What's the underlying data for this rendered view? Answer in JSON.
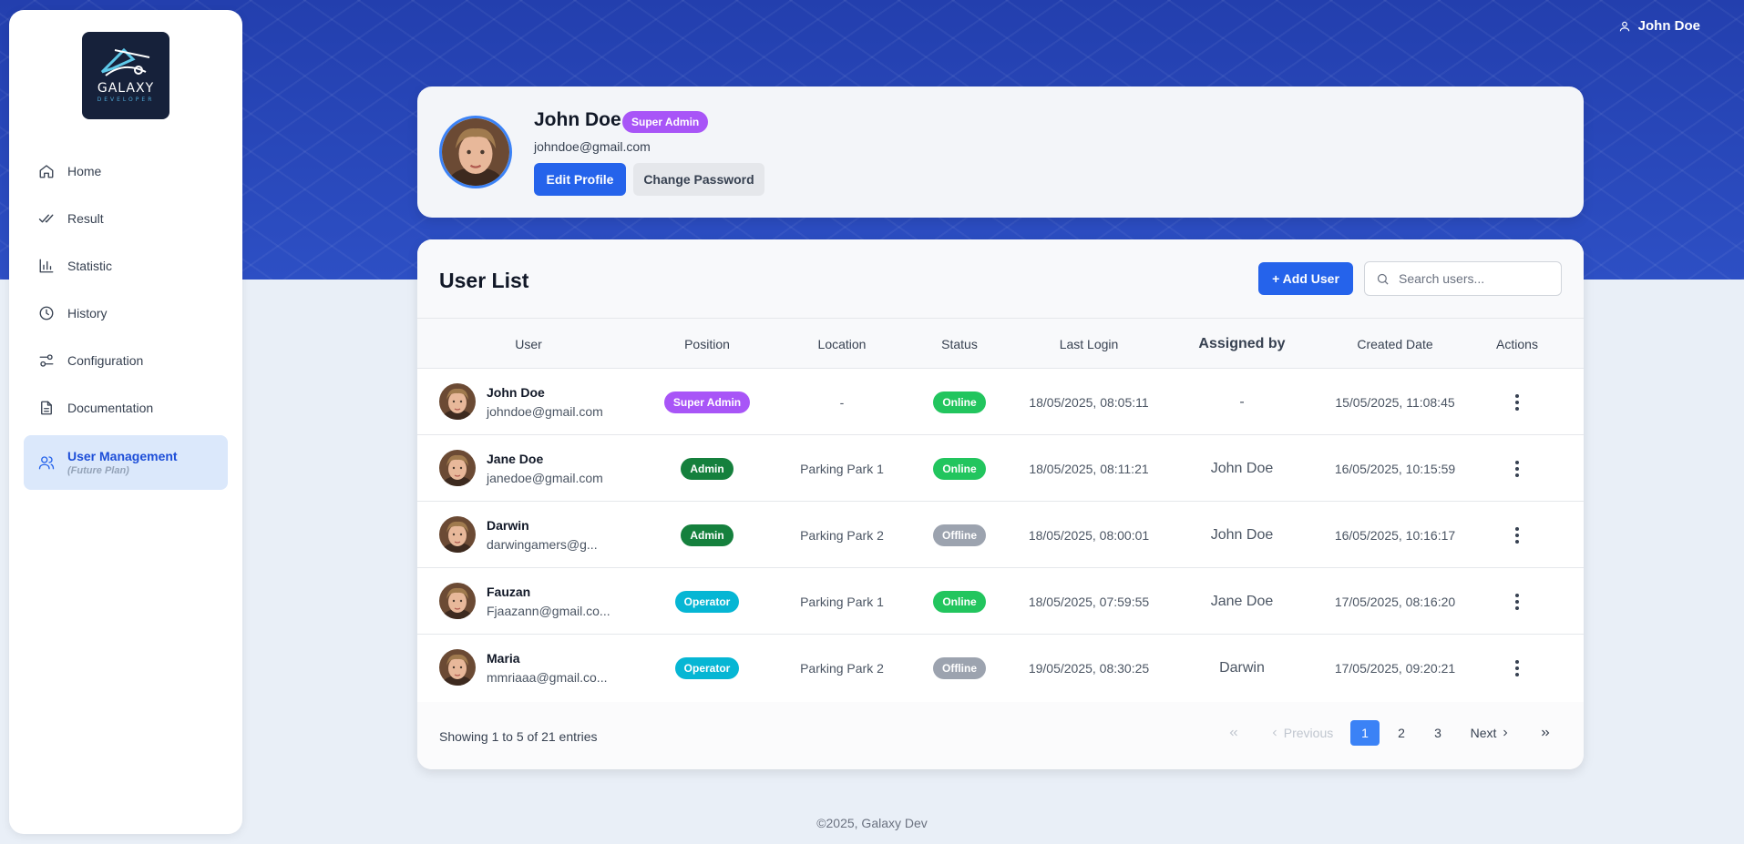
{
  "header": {
    "user_name": "John Doe",
    "user_icon": "user-icon"
  },
  "brand": {
    "name": "GALAXY",
    "tagline": "DEVELOPER"
  },
  "sidebar": {
    "items": [
      {
        "label": "Home",
        "icon": "home-icon"
      },
      {
        "label": "Result",
        "icon": "double-check-icon"
      },
      {
        "label": "Statistic",
        "icon": "bar-chart-icon"
      },
      {
        "label": "History",
        "icon": "clock-icon"
      },
      {
        "label": "Configuration",
        "icon": "sliders-icon"
      },
      {
        "label": "Documentation",
        "icon": "document-icon"
      },
      {
        "label": "User Management",
        "sublabel": "(Future Plan)",
        "icon": "users-icon",
        "active": true
      }
    ]
  },
  "profile": {
    "name": "John Doe",
    "role": "Super Admin",
    "email": "johndoe@gmail.com",
    "edit_label": "Edit Profile",
    "change_password_label": "Change Password"
  },
  "user_list": {
    "title": "User List",
    "add_label": "+ Add User",
    "search_placeholder": "Search users...",
    "columns": [
      "User",
      "Position",
      "Location",
      "Status",
      "Last Login",
      "Assigned by",
      "Created Date",
      "Actions"
    ],
    "rows": [
      {
        "name": "John Doe",
        "email": "johndoe@gmail.com",
        "position": "Super Admin",
        "location": "-",
        "status": "Online",
        "last_login": "18/05/2025, 08:05:11",
        "assigned_by": "-",
        "created": "15/05/2025, 11:08:45"
      },
      {
        "name": "Jane Doe",
        "email": "janedoe@gmail.com",
        "position": "Admin",
        "location": "Parking Park 1",
        "status": "Online",
        "last_login": "18/05/2025, 08:11:21",
        "assigned_by": "John Doe",
        "created": "16/05/2025, 10:15:59"
      },
      {
        "name": "Darwin",
        "email": "darwingamers@g...",
        "position": "Admin",
        "location": "Parking Park 2",
        "status": "Offline",
        "last_login": "18/05/2025, 08:00:01",
        "assigned_by": "John Doe",
        "created": "16/05/2025, 10:16:17"
      },
      {
        "name": "Fauzan",
        "email": "Fjaazann@gmail.co...",
        "position": "Operator",
        "location": "Parking Park 1",
        "status": "Online",
        "last_login": "18/05/2025, 07:59:55",
        "assigned_by": "Jane Doe",
        "created": "17/05/2025, 08:16:20"
      },
      {
        "name": "Maria",
        "email": "mmriaaa@gmail.co...",
        "position": "Operator",
        "location": "Parking Park 2",
        "status": "Offline",
        "last_login": "19/05/2025, 08:30:25",
        "assigned_by": "Darwin",
        "created": "17/05/2025, 09:20:21"
      }
    ]
  },
  "pagination": {
    "summary": "Showing 1 to 5 of 21 entries",
    "first_icon": "double-chevron-left-icon",
    "previous_label": "Previous",
    "pages": [
      "1",
      "2",
      "3"
    ],
    "current_page": "1",
    "next_label": "Next",
    "last_icon": "double-chevron-right-icon"
  },
  "footer": {
    "copyright": "©2025, Galaxy Dev"
  },
  "colors": {
    "primary": "#2563eb",
    "super_admin": "#a855f7",
    "admin": "#15803d",
    "operator": "#06b6d4",
    "online": "#22c55e",
    "offline": "#9ca3af",
    "hero": "#2744b4"
  }
}
